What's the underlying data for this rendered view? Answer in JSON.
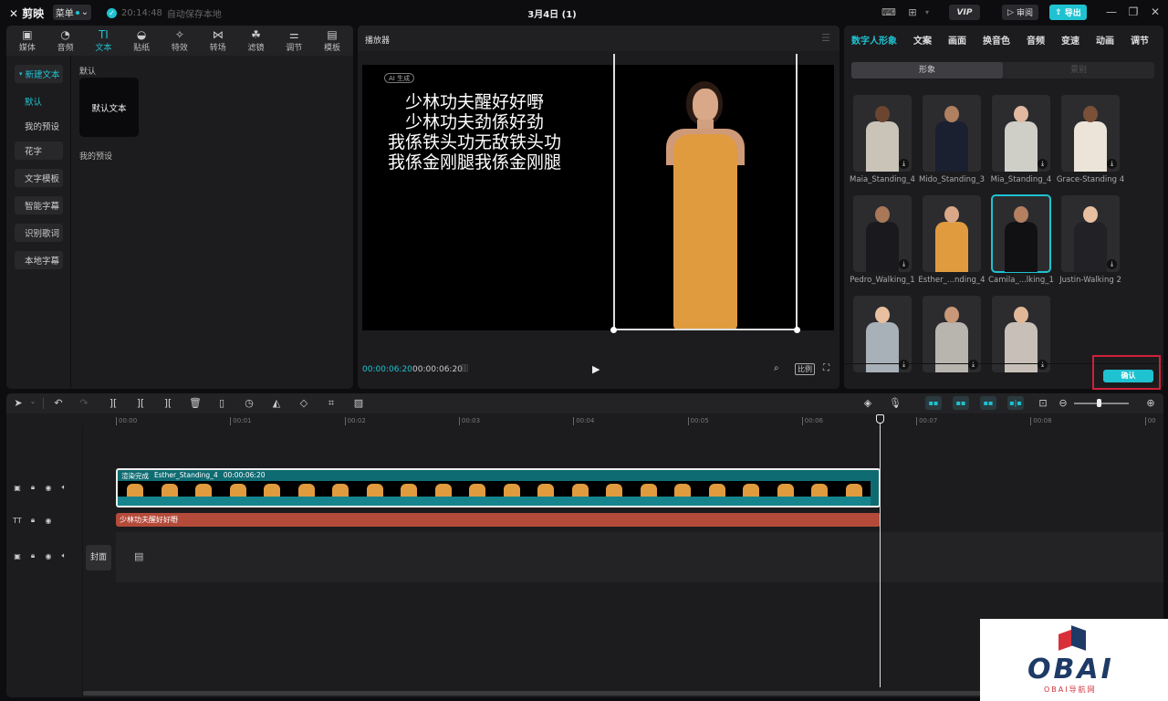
{
  "app": {
    "name": "剪映",
    "menu_label": "菜单",
    "save_time": "20:14:48",
    "save_text": "自动保存本地",
    "doc_title": "3月4日 (1)"
  },
  "titlebar": {
    "vip_label": "VIP",
    "review_label": "审阅",
    "export_label": "导出"
  },
  "left_tabs": [
    {
      "label": "媒体",
      "icon": "▣"
    },
    {
      "label": "音频",
      "icon": "◔"
    },
    {
      "label": "文本",
      "icon": "TI"
    },
    {
      "label": "贴纸",
      "icon": "◒"
    },
    {
      "label": "特效",
      "icon": "✧"
    },
    {
      "label": "转场",
      "icon": "⋈"
    },
    {
      "label": "滤镜",
      "icon": "☘"
    },
    {
      "label": "调节",
      "icon": "⚌"
    },
    {
      "label": "模板",
      "icon": "▤"
    }
  ],
  "sidenav": {
    "new_text": "新建文本",
    "default": "默认",
    "my_presets": "我的预设",
    "items": [
      "花字",
      "文字模板",
      "智能字幕",
      "识别歌词",
      "本地字幕"
    ]
  },
  "text_content": {
    "default_section": "默认",
    "default_card": "默认文本",
    "my_presets_section": "我的预设"
  },
  "player": {
    "title": "播放器",
    "ai_badge": "AI 生成",
    "lyrics": [
      "少林功夫醒好好嘢",
      "少林功夫劲係好劲",
      "我係铁头功无敌铁头功",
      "我係金刚腿我係金刚腿"
    ],
    "current_time": "00:00:06:20",
    "total_time": "00:00:06:20",
    "ratio_label": "比例"
  },
  "right_tabs": [
    "数字人形象",
    "文案",
    "画面",
    "换音色",
    "音频",
    "变速",
    "动画",
    "调节"
  ],
  "segment": {
    "a": "形象",
    "b": "景别"
  },
  "avatars": [
    {
      "name": "Maia_Standing_4",
      "skin": "#6b4530",
      "top": "#c9c3b8",
      "download": true
    },
    {
      "name": "Mido_Standing_3",
      "skin": "#b08060",
      "top": "#1a2030",
      "download": false
    },
    {
      "name": "Mia_Standing_4",
      "skin": "#e0b9a0",
      "top": "#cfcfc8",
      "download": true
    },
    {
      "name": "Grace-Standing 4",
      "skin": "#7a5038",
      "top": "#ece4d8",
      "download": true
    },
    {
      "name": "Pedro_Walking_1",
      "skin": "#a87858",
      "top": "#1a1a1e",
      "download": true
    },
    {
      "name": "Esther_...nding_4",
      "skin": "#d8a888",
      "top": "#e19b3f",
      "download": false
    },
    {
      "name": "Camila_...lking_1",
      "skin": "#b48060",
      "top": "#111114",
      "download": false,
      "selected": true
    },
    {
      "name": "Justin-Walking 2",
      "skin": "#e8c0a0",
      "top": "#222226",
      "download": true
    },
    {
      "name": "",
      "skin": "#e8c0a0",
      "top": "#a8b0b8",
      "download": true
    },
    {
      "name": "",
      "skin": "#c89878",
      "top": "#b8b4ae",
      "download": true
    },
    {
      "name": "",
      "skin": "#e0b898",
      "top": "#c8c0b8",
      "download": true
    }
  ],
  "confirm_label": "确认",
  "timeline": {
    "ticks": [
      "00:00",
      "00:01",
      "00:02",
      "00:03",
      "00:04",
      "00:05",
      "00:06",
      "00:07",
      "00:08",
      "00"
    ],
    "video_clip": {
      "status": "渲染完成",
      "name": "Esther_Standing_4",
      "duration": "00:00:06:20"
    },
    "text_clip": "少林功夫醒好好嘢",
    "cover_label": "封面",
    "zoom_level": 0.45
  },
  "watermark": {
    "text": "OBAI",
    "sub": "OBAI导航网"
  }
}
